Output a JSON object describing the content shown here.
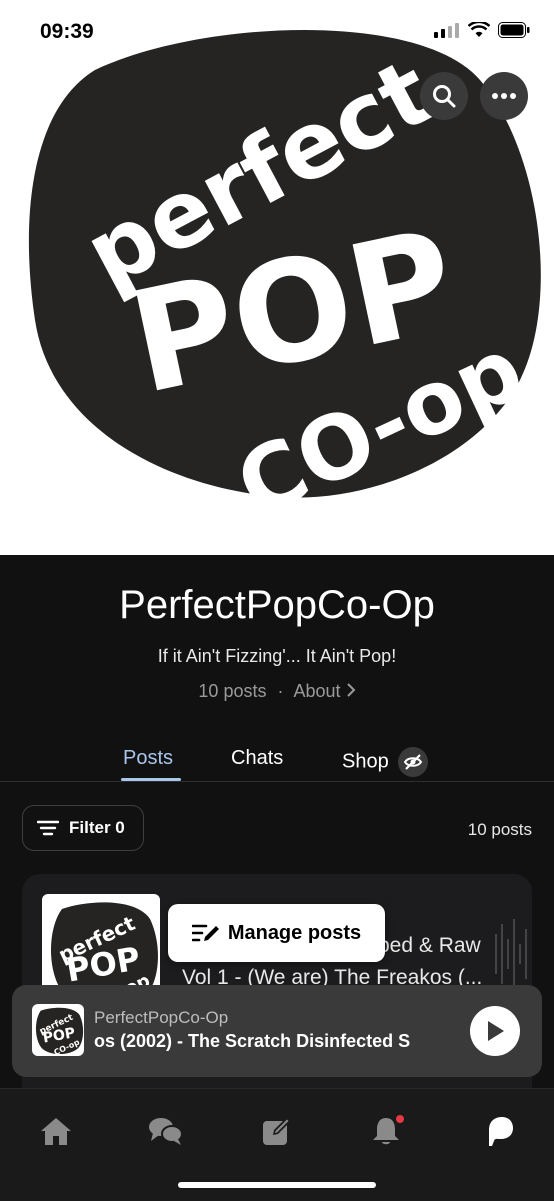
{
  "status_bar": {
    "time": "09:39"
  },
  "hero": {
    "logo_text": [
      "Perfect",
      "POP",
      "CO-OP"
    ]
  },
  "profile": {
    "name": "PerfectPopCo-Op",
    "tagline": "If it Ain't Fizzing'... It Ain't Pop!",
    "posts_count": "10 posts",
    "separator": "·",
    "about_label": "About"
  },
  "tabs": [
    {
      "label": "Posts",
      "active": true
    },
    {
      "label": "Chats",
      "active": false
    },
    {
      "label": "Shop",
      "active": false
    }
  ],
  "filter": {
    "label": "Filter 0",
    "count_label": "10 posts"
  },
  "post_card": {
    "title_line1": "bed & Raw",
    "title_line2": "Vol 1 - (We are) The Freakos (..."
  },
  "manage_posts": {
    "label": "Manage posts"
  },
  "mini_player": {
    "artist": "PerfectPopCo-Op",
    "track": "os (2002) - The Scratch   Disinfected S"
  },
  "colors": {
    "accent": "#a9c6ec",
    "background": "#111111",
    "card": "#1c1c1e",
    "player": "#3a3a3a",
    "notification": "#e63946"
  },
  "icons": [
    "search-icon",
    "more-icon",
    "hidden-eye-icon",
    "filter-icon",
    "edit-list-icon",
    "play-icon",
    "home-icon",
    "chats-icon",
    "compose-icon",
    "bell-icon",
    "patreon-icon"
  ]
}
